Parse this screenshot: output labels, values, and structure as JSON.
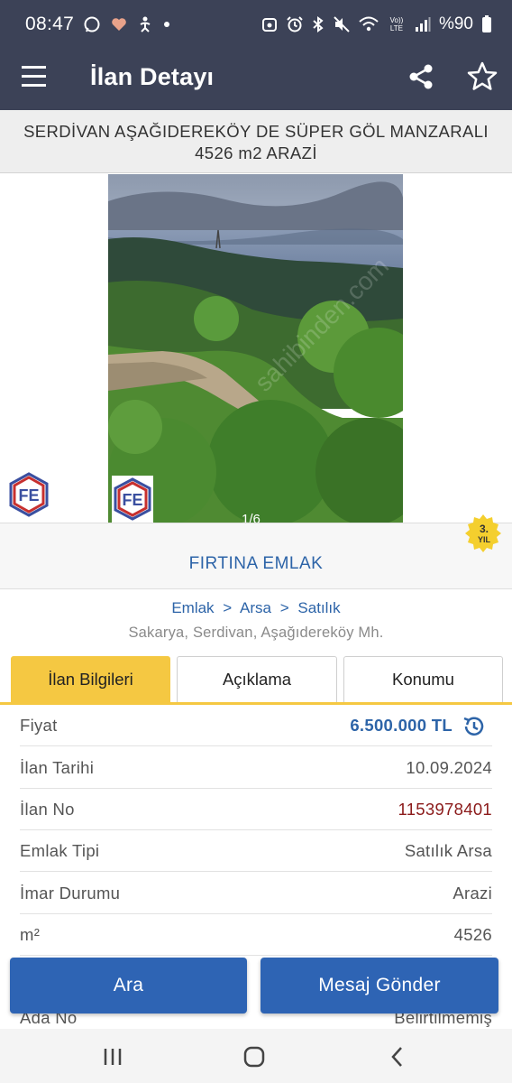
{
  "status_bar": {
    "time": "08:47",
    "battery": "%90",
    "icons": [
      "whatsapp-icon",
      "health-icon",
      "accessibility-icon",
      "dot-icon",
      "camera-icon",
      "alarm-icon",
      "bluetooth-icon",
      "mute-icon",
      "wifi-icon",
      "volte-icon",
      "signal-icon",
      "battery-icon"
    ],
    "volte_label": "Vo)) LTE"
  },
  "app_bar": {
    "title": "İlan Detayı",
    "icons": [
      "menu-icon",
      "share-icon",
      "star-icon"
    ]
  },
  "listing": {
    "title_line1": "SERDİVAN AŞAĞIDEREKÖY DE SÜPER GÖL MANZARALI",
    "title_line2": "4526 m2 ARAZİ"
  },
  "gallery": {
    "counter": "1/6",
    "watermark": "sahibinden.com"
  },
  "agency": {
    "name": "FIRTINA EMLAK",
    "badge_number": "3.",
    "badge_unit": "YIL"
  },
  "breadcrumb": {
    "items": [
      "Emlak",
      "Arsa",
      "Satılık"
    ],
    "separator": ">"
  },
  "location": "Sakarya, Serdivan, Aşağıdereköy Mh.",
  "tabs": [
    {
      "label": "İlan Bilgileri",
      "active": true
    },
    {
      "label": "Açıklama",
      "active": false
    },
    {
      "label": "Konumu",
      "active": false
    }
  ],
  "details": [
    {
      "label": "Fiyat",
      "value": "6.500.000 TL"
    },
    {
      "label": "İlan Tarihi",
      "value": "10.09.2024"
    },
    {
      "label": "İlan No",
      "value": "1153978401"
    },
    {
      "label": "Emlak Tipi",
      "value": "Satılık Arsa"
    },
    {
      "label": "İmar Durumu",
      "value": "Arazi"
    },
    {
      "label": "m²",
      "value": "4526"
    },
    {
      "label": "Ada No",
      "value": "Belirtilmemiş"
    }
  ],
  "actions": {
    "call": "Ara",
    "message": "Mesaj Gönder"
  },
  "colors": {
    "header": "#3c4257",
    "accent_blue": "#2d64a8",
    "button_blue": "#2e64b4",
    "tab_active": "#f5c842",
    "listing_no": "#8b1a1a"
  }
}
